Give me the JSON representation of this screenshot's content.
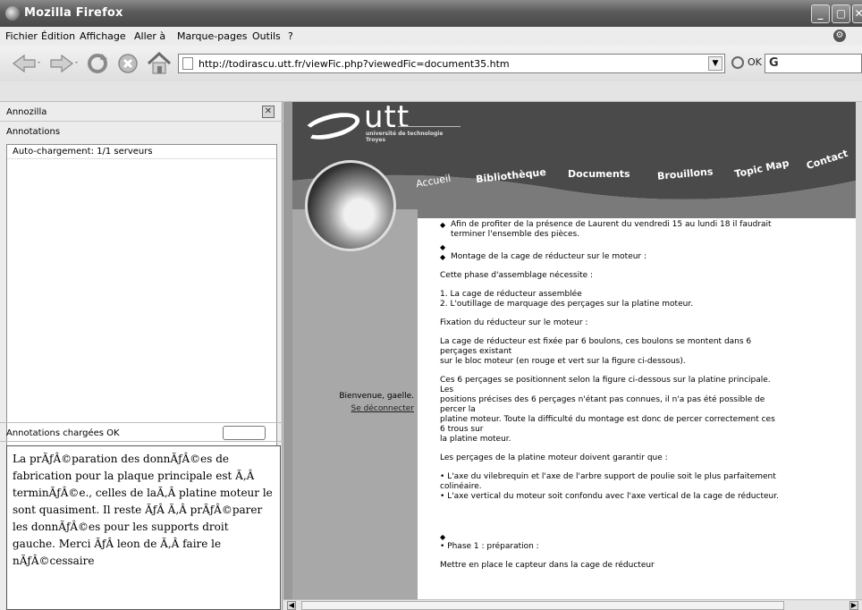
{
  "window": {
    "title": "Mozilla Firefox"
  },
  "menu": {
    "items": [
      {
        "label": "Fichier"
      },
      {
        "label": "Édition"
      },
      {
        "label": "Affichage"
      },
      {
        "label": "Aller à"
      },
      {
        "label": "Marque-pages"
      },
      {
        "label": "Outils"
      },
      {
        "label": "?"
      }
    ]
  },
  "navbar": {
    "url": "http://todirascu.utt.fr/viewFic.php?viewedFic=document35.htm",
    "go_label": "OK",
    "search_label": "G"
  },
  "sidebar": {
    "title": "Annozilla",
    "section_label": "Annotations",
    "list_rows": [
      "Auto-chargement: 1/1 serveurs"
    ],
    "status": "Annotations chargées OK",
    "note": "La prÃƒÂ©paration des donnÃƒÂ©es de fabrication pour la plaque principale est Ã‚Â terminÃƒÂ©e., celles de laÃ‚Â  platine moteur le sont quasiment. Il reste ÃƒÂ Ã‚Â prÃƒÂ©parer les donnÃƒÂ©es pour les supports droit gauche. Merci ÃƒÂ  leon de Ã‚Â faire le nÃƒÂ©cessaire"
  },
  "site": {
    "logo": "utt",
    "logo_sub_line1": "université de technologie",
    "logo_sub_line2": "Troyes",
    "nav": [
      "Accueil",
      "Bibliothèque",
      "Documents",
      "Brouillons",
      "Topic Map",
      "Contact"
    ],
    "welcome": "Bienvenue, gaelle.",
    "logout": "Se déconnecter",
    "article": {
      "p1": "Afin de profiter de la présence de Laurent du vendredi 15 au lundi 18 il faudrait terminer l'ensemble des pièces.",
      "p2": "Montage de la cage de réducteur sur le moteur :",
      "p3": "Cette phase d'assemblage nécessite :",
      "p4a": "1. La cage de réducteur assemblée",
      "p4b": "2. L'outillage de marquage des perçages sur la platine moteur.",
      "p5": "Fixation du réducteur sur le moteur :",
      "p6a": "La cage de réducteur est fixée par 6 boulons, ces boulons se montent dans 6 perçages existant",
      "p6b": "sur le bloc moteur (en rouge et vert sur la figure ci-dessous).",
      "p7a": "Ces 6 perçages se positionnent selon la figure ci-dessous sur la platine principale. Les",
      "p7b": "positions précises des 6 perçages n'étant pas connues, il n'a pas été possible de percer la",
      "p7c": "platine moteur. Toute la difficulté du montage est donc de percer correctement ces 6 trous sur",
      "p7d": "la platine moteur.",
      "p8": "Les perçages de la platine moteur doivent garantir que :",
      "p9a": "• L'axe du vilebrequin et l'axe de l'arbre support de poulie soit le plus parfaitement",
      "p9b": "colinéaire.",
      "p9c": "• L'axe vertical du moteur soit confondu avec l'axe vertical de la cage de réducteur.",
      "p10": "• Phase 1 : préparation :",
      "p11": "Mettre en place le capteur dans la cage de réducteur"
    }
  }
}
